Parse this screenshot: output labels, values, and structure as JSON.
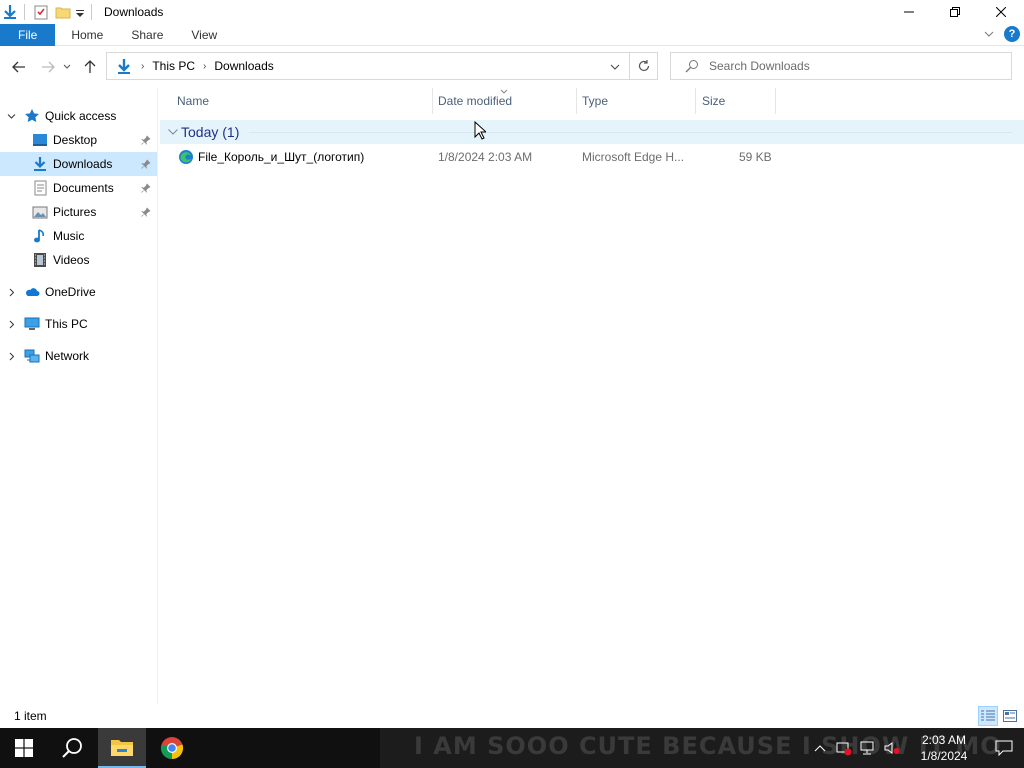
{
  "window": {
    "title": "Downloads"
  },
  "ribbon": {
    "tabs": [
      {
        "label": "File"
      },
      {
        "label": "Home"
      },
      {
        "label": "Share"
      },
      {
        "label": "View"
      }
    ],
    "help_label": "?"
  },
  "address": {
    "crumbs": [
      "This PC",
      "Downloads"
    ]
  },
  "search": {
    "placeholder": "Search Downloads"
  },
  "nav": {
    "items": [
      {
        "label": "Quick access",
        "icon": "star-icon"
      },
      {
        "label": "Desktop",
        "icon": "desktop-icon"
      },
      {
        "label": "Downloads",
        "icon": "download-icon",
        "selected": true
      },
      {
        "label": "Documents",
        "icon": "documents-icon"
      },
      {
        "label": "Pictures",
        "icon": "pictures-icon"
      },
      {
        "label": "Music",
        "icon": "music-icon"
      },
      {
        "label": "Videos",
        "icon": "videos-icon"
      },
      {
        "label": "OneDrive",
        "icon": "onedrive-icon"
      },
      {
        "label": "This PC",
        "icon": "this-pc-icon"
      },
      {
        "label": "Network",
        "icon": "network-icon"
      }
    ]
  },
  "columns": {
    "name": "Name",
    "date": "Date modified",
    "type": "Type",
    "size": "Size"
  },
  "group": {
    "label": "Today (1)"
  },
  "files": [
    {
      "name": "File_Король_и_Шут_(логотип)",
      "date": "1/8/2024 2:03 AM",
      "type": "Microsoft Edge H...",
      "size": "59 KB"
    }
  ],
  "status": {
    "count": "1 item"
  },
  "taskbar": {
    "wallpaper_text": "I AM SOOO CUTE BECAUSE I SHOW IT MO",
    "time": "2:03 AM",
    "date": "1/8/2024"
  },
  "colors": {
    "accent": "#1979ca",
    "selection": "#cce8ff",
    "group_text": "#1e3287",
    "taskbar": "#101010"
  }
}
